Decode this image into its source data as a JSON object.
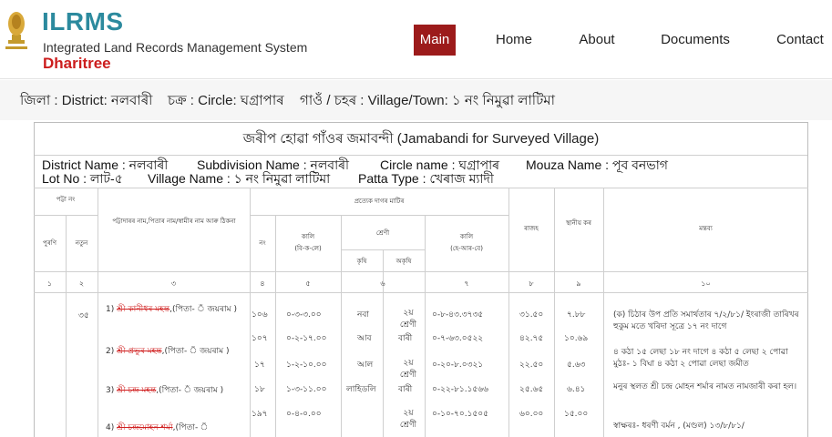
{
  "header": {
    "title": "ILRMS",
    "subtitle": "Integrated Land Records Management System",
    "name": "Dharitree",
    "nav": [
      {
        "label": "Main"
      },
      {
        "label": "Home"
      },
      {
        "label": "About"
      },
      {
        "label": "Documents"
      },
      {
        "label": "Contact"
      }
    ]
  },
  "location": {
    "district": "জিলা : District: নলবাৰী",
    "circle": "চক্ৰ : Circle: ঘগ্ৰাপাৰ",
    "village": "গাওঁ / চহৰ : Village/Town: ১ নং নিমুৱা লাটিমা"
  },
  "doc": {
    "title": "জৰীপ হোৱা গাঁওৰ জমাবন্দী (Jamabandi for Surveyed Village)",
    "district_label": "District Name",
    "district_value": ": নলবাৰী",
    "subdivision_label": "Subdivision Name",
    "subdivision_value": ": নলবাৰী",
    "circle_label": "Circle name",
    "circle_value": ": ঘগ্ৰাপাৰ",
    "mouza_label": "Mouza Name",
    "mouza_value": ": পূব বনভাগ",
    "lot_label": "Lot No",
    "lot_value": ": লাট-৫",
    "village_label": "Village Name",
    "village_value": ": ১ নং নিমুৱা লাটিমা",
    "patta_label": "Patta Type",
    "patta_value": ": খেৰাজ ম্যাদী"
  },
  "table": {
    "h_patta_no": "পট্টা নং",
    "h_old": "পুৰণি",
    "h_new": "নতুন",
    "h_owner": "পট্টাদাৰৰ নাম,পিতাৰ নাম/স্বামীৰ নাম আৰু ঠিকনা",
    "h_dag_group": "প্ৰত্যেক দাগৰ মাটিৰ",
    "h_dag_no": "নং",
    "h_area_bkl": "কালি",
    "h_area_bkl_unit": "(বি-ক-লে)",
    "h_class": "শ্ৰেণী",
    "h_class_agri": "কৃষি",
    "h_class_nonagri": "অকৃষি",
    "h_area_hare": "কালি",
    "h_area_hare_unit": "(হে-আৰ-বে)",
    "h_revenue": "ৰাজহ",
    "h_local_tax": "স্থানীয় কৰ",
    "h_remarks": "মন্তব্য",
    "col_nums": [
      "১",
      "২",
      "৩",
      "৪",
      "৫",
      "৬",
      "৭",
      "৮",
      "৯",
      "১০"
    ],
    "patta_new": "৩৫",
    "owners": [
      {
        "num": "1)",
        "name": "শ্ৰী কানীধৰ মহন্ত",
        "rest": ",(পিতা- ঁ জয়ৰাম )"
      },
      {
        "num": "2)",
        "name": "শ্ৰী প্ৰভুৰ মহন্ত",
        "rest": ",(পিতা- ঁ জয়ৰাম )"
      },
      {
        "num": "3)",
        "name": "শ্ৰী চন্দ্ৰ মহন্ত",
        "rest": ",(পিতা- ঁ জয়ৰাম )"
      },
      {
        "num": "4)",
        "name": "শ্ৰী চন্দ্ৰমোহন শৰ্মা",
        "rest": ",(পিতা- ঁ"
      }
    ],
    "rows": [
      {
        "dag": "১০৬",
        "bkl": "০-৩-৩.০০",
        "class": "নবা",
        "nonagri": "২য় শ্ৰেণী",
        "hare": "০-৮-৪৩.৩৭৩৫",
        "rev": "৩১.৫০",
        "tax": "৭.৮৮"
      },
      {
        "dag": "১০৭",
        "bkl": "০-২-১৭.০০",
        "class": "আব",
        "nonagri": "বাৰী",
        "hare": "০-৭-৬৩.০৫২২",
        "rev": "৪২.৭৫",
        "tax": "১০.৬৯"
      },
      {
        "dag": "১৭",
        "bkl": "১-২-১০.০০",
        "class": "আল",
        "nonagri": "২য় শ্ৰেণী",
        "hare": "০-২০-৮.০৩২১",
        "rev": "২২.৫০",
        "tax": "৫.৬৩"
      },
      {
        "dag": "১৮",
        "bkl": "১-৩-১১.০০",
        "class": "লাহিডলি",
        "nonagri": "বাৰী",
        "hare": "০-২২-৮১.১৫৬৬",
        "rev": "২৫.৬৫",
        "tax": "৬.৪১"
      },
      {
        "dag": "১৯৭",
        "bkl": "০-৪-০.০০",
        "class": "",
        "nonagri": "২য় শ্ৰেণী",
        "hare": "০-১০-৭০.১৫০৫",
        "rev": "৬০.০০",
        "tax": "১৫.০০"
      }
    ],
    "remarks": [
      "(ক) চিঠাৰ উপ প্ৰতি সমাৰ্থতাৰ ৭/২/৮১/ ইংৰাজী তাৰিখৰ হুকুম মতে খৰিদা সূত্ৰে ১৭ নং দাগে",
      "৪ কঠা ১৫ লেছা ১৮ নং দাগে ৪ কঠা ৫ লেছা ২ পোৱা মুঠঃ- ১ বিঘা ৪ কঠা ২ পোৱা লেছা জমীত",
      "মনুৰ স্থলত শ্ৰী চন্দ্ৰ মোহন শৰ্মাৰ নামত নামজাৰী কৰা হল।",
      "স্বাক্ষৰঃ- ধৰণী বৰ্মন , (মণ্ডল) ১৩/৮/৮১/"
    ]
  }
}
